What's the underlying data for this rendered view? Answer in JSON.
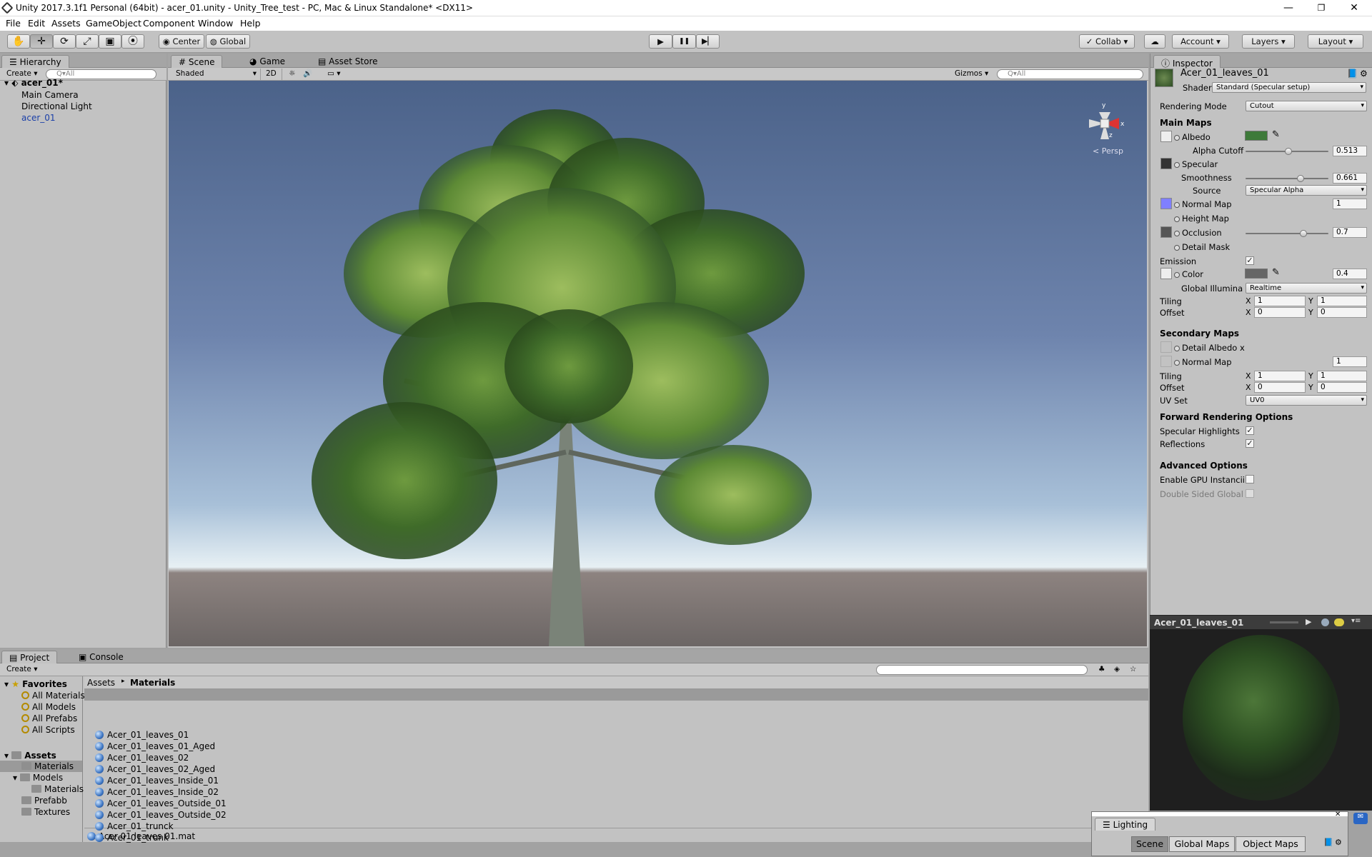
{
  "window": {
    "title": "Unity 2017.3.1f1 Personal (64bit) - acer_01.unity - Unity_Tree_test - PC, Mac & Linux Standalone* <DX11>",
    "minimize": "—",
    "maximize": "❐",
    "close": "✕"
  },
  "menu": [
    "File",
    "Edit",
    "Assets",
    "GameObject",
    "Component",
    "Window",
    "Help"
  ],
  "toolbar": {
    "pivot": "Center",
    "space": "Global",
    "collab": "Collab",
    "account": "Account",
    "layers": "Layers",
    "layout": "Layout",
    "play": "▶",
    "pause": "❚❚",
    "step": "▶▏",
    "pivot_icon": "◉",
    "global_icon": "◍",
    "collab_check": "✓",
    "cloud": "☁"
  },
  "tool_icons": [
    "hand-icon",
    "move-icon",
    "rotate-icon",
    "scale-icon",
    "rect-icon",
    "transform-icon"
  ],
  "tool_glyphs": [
    "✋",
    "✛",
    "⟳",
    "⤢",
    "▣",
    "⦿"
  ],
  "hierarchy": {
    "tab": "Hierarchy",
    "create": "Create ▾",
    "search": "Q▾All",
    "scene": "acer_01*",
    "items": [
      "Main Camera",
      "Directional Light",
      "acer_01"
    ]
  },
  "scene": {
    "tabs": [
      "Scene",
      "Game",
      "Asset Store"
    ],
    "shading": "Shaded",
    "mode2d": "2D",
    "gizmos": "Gizmos ▾",
    "search": "Q▾All",
    "persp": "< Persp",
    "axis_y": "y",
    "axis_x": "x",
    "axis_z": "z"
  },
  "inspector": {
    "tab": "Inspector",
    "name": "Acer_01_leaves_01",
    "shader_label": "Shader",
    "shader": "Standard (Specular setup)",
    "rendering_mode_label": "Rendering Mode",
    "rendering_mode": "Cutout",
    "main_maps": "Main Maps",
    "albedo": "Albedo",
    "alpha_cutoff": "Alpha Cutoff",
    "alpha_cutoff_val": "0.513",
    "alpha_cutoff_level": 0.513,
    "specular": "Specular",
    "smoothness": "Smoothness",
    "smoothness_val": "0.661",
    "smoothness_level": 0.661,
    "source": "Source",
    "source_val": "Specular Alpha",
    "normal_map": "Normal Map",
    "normal_val": "1",
    "height_map": "Height Map",
    "occlusion": "Occlusion",
    "occlusion_val": "0.7",
    "occlusion_level": 0.7,
    "detail_mask": "Detail Mask",
    "emission": "Emission",
    "color": "Color",
    "color_val": "0.4",
    "gi": "Global Illumina",
    "gi_val": "Realtime",
    "tiling": "Tiling",
    "offset": "Offset",
    "x": "X",
    "y": "Y",
    "tiling_x": "1",
    "tiling_y": "1",
    "offset_x": "0",
    "offset_y": "0",
    "secondary_maps": "Secondary Maps",
    "detail_albedo": "Detail Albedo x",
    "normal_map2": "Normal Map",
    "normal_val2": "1",
    "tiling2_x": "1",
    "tiling2_y": "1",
    "offset2_x": "0",
    "offset2_y": "0",
    "uv_set": "UV Set",
    "uv_set_val": "UV0",
    "forward": "Forward Rendering Options",
    "spec_high": "Specular Highlights",
    "reflections": "Reflections",
    "advanced": "Advanced Options",
    "gpu": "Enable GPU Instancii",
    "double_sided": "Double Sided Global",
    "check": "✓"
  },
  "preview": {
    "title": "Acer_01_leaves_01",
    "play": "▶"
  },
  "project": {
    "tabs": [
      "Project",
      "Console"
    ],
    "create": "Create ▾",
    "favorites_label": "Favorites",
    "favorites": [
      "All Materials",
      "All Models",
      "All Prefabs",
      "All Scripts"
    ],
    "assets_label": "Assets",
    "folders": [
      "Materials",
      "Models",
      "Materials",
      "Prefabb",
      "Textures"
    ],
    "breadcrumb": [
      "Assets",
      "Materials"
    ],
    "breadcrumb_sep": "▸",
    "files": [
      "Acer_01_leaves_01",
      "Acer_01_leaves_01_Aged",
      "Acer_01_leaves_02",
      "Acer_01_leaves_02_Aged",
      "Acer_01_leaves_Inside_01",
      "Acer_01_leaves_Inside_02",
      "Acer_01_leaves_Outside_01",
      "Acer_01_leaves_Outside_02",
      "Acer_01_trunck",
      "Acer_01_trunk"
    ],
    "status": "Acer  01  leaves  01.mat"
  },
  "lighting": {
    "title": "Lighting",
    "tabs": [
      "Scene",
      "Global Maps",
      "Object Maps"
    ],
    "close": "✕"
  }
}
